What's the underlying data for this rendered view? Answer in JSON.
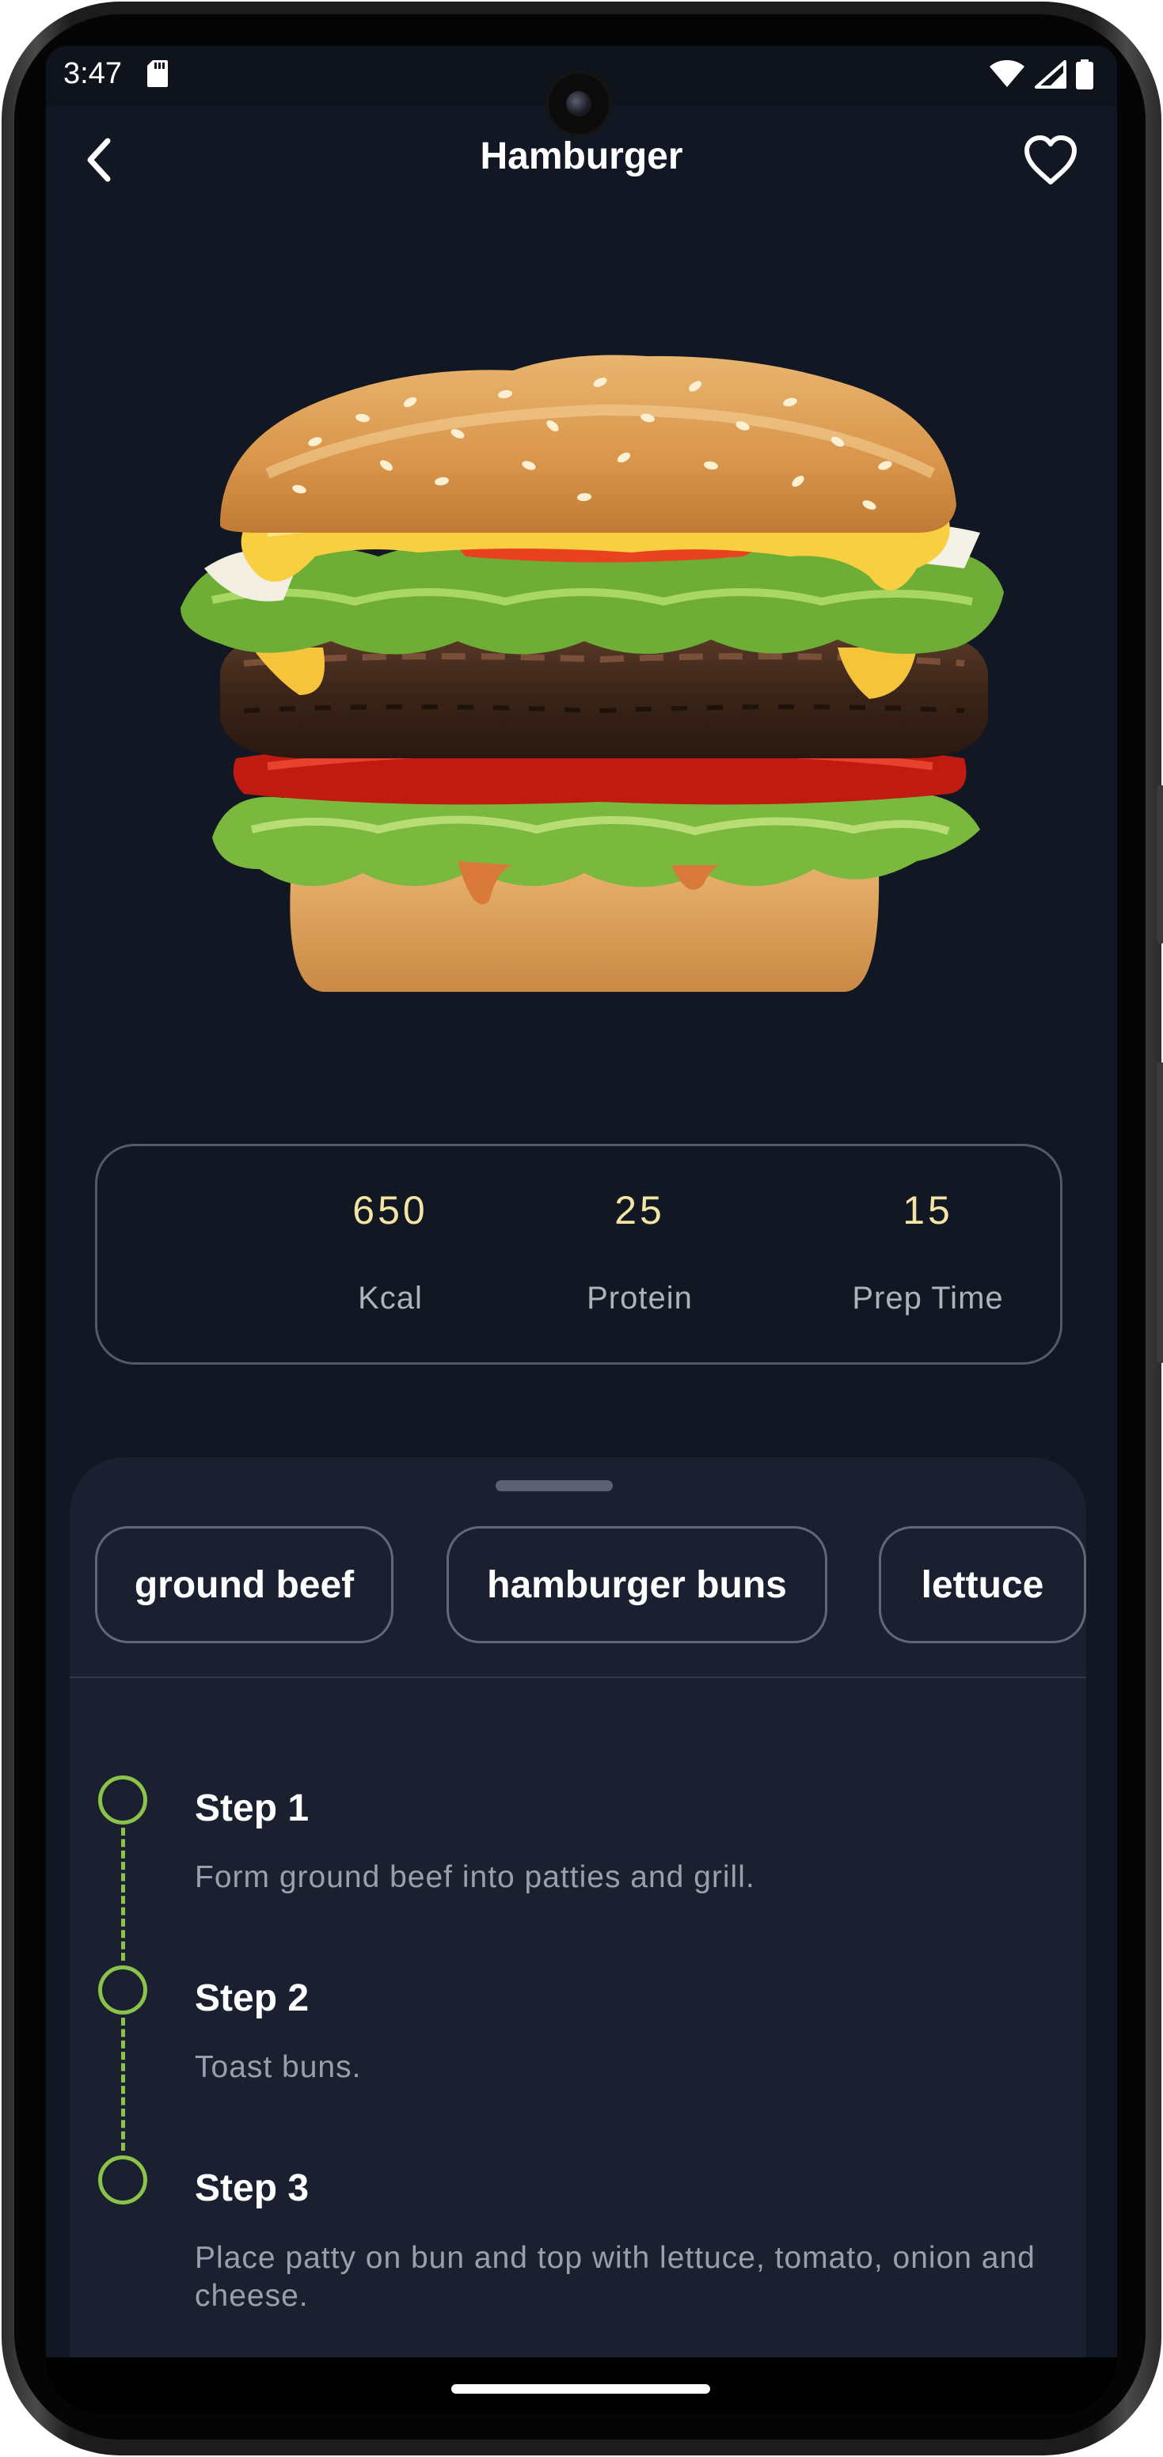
{
  "status_bar": {
    "time": "3:47"
  },
  "header": {
    "title": "Hamburger"
  },
  "stats": [
    {
      "value": "650",
      "label": "Kcal"
    },
    {
      "value": "25",
      "label": "Protein"
    },
    {
      "value": "15",
      "label": "Prep Time"
    }
  ],
  "ingredients": [
    "ground beef",
    "hamburger buns",
    "lettuce"
  ],
  "steps": [
    {
      "title": "Step 1",
      "description": "Form ground beef into patties and grill."
    },
    {
      "title": "Step 2",
      "description": "Toast buns."
    },
    {
      "title": "Step 3",
      "description": "Place patty on bun and top with lettuce, tomato, onion and cheese."
    }
  ],
  "colors": {
    "background": "#111723",
    "sheet": "#1b2031",
    "stat_value": "#f4e4a4",
    "timeline_accent": "#8bc34a",
    "text_primary": "#ffffff",
    "text_secondary": "#9aa0ab"
  },
  "icons": {
    "back": "back-arrow-icon",
    "favorite": "heart-outline-icon",
    "sd_card": "sd-card-icon",
    "wifi": "wifi-icon",
    "signal": "cell-signal-icon",
    "battery": "battery-icon"
  }
}
